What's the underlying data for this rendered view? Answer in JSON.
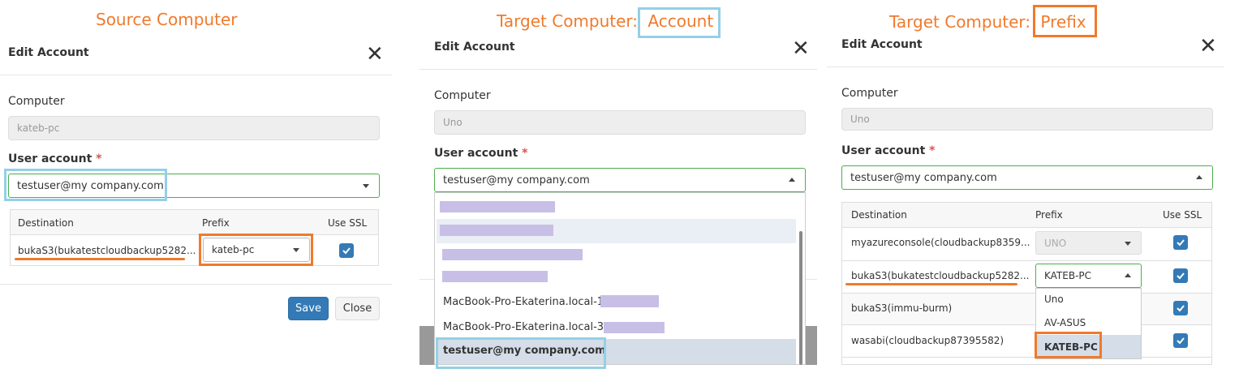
{
  "colors": {
    "accent_orange": "#f07a2c",
    "accent_blue": "#93d0e6",
    "primary": "#337ab7",
    "required": "#d9534f"
  },
  "panel1": {
    "caption": "Source Computer",
    "title": "Edit Account",
    "computer_label": "Computer",
    "computer_value": "kateb-pc",
    "user_account_label": "User account",
    "required_mark": "*",
    "user_account_value": "testuser@my company.com",
    "table_headers": {
      "destination": "Destination",
      "prefix": "Prefix",
      "use_ssl": "Use SSL"
    },
    "rows": [
      {
        "destination": "bukaS3(bukatestcloudbackup5282...",
        "prefix": "kateb-pc",
        "use_ssl": true
      }
    ],
    "save_label": "Save",
    "close_label": "Close"
  },
  "panel2": {
    "caption_prefix": "Target Computer: ",
    "caption_highlight": "Account",
    "title": "Edit Account",
    "computer_label": "Computer",
    "computer_value": "Uno",
    "user_account_label": "User account",
    "required_mark": "*",
    "user_account_value": "testuser@my company.com",
    "dropdown_options": [
      "",
      "",
      "",
      "",
      "MacBook-Pro-Ekaterina.local-1E",
      "MacBook-Pro-Ekaterina.local-3A3",
      "testuser@my company.com"
    ]
  },
  "panel3": {
    "caption_prefix": "Target Computer: ",
    "caption_highlight": "Prefix",
    "title": "Edit Account",
    "computer_label": "Computer",
    "computer_value": "Uno",
    "user_account_label": "User account",
    "required_mark": "*",
    "user_account_value": "testuser@my company.com",
    "table_headers": {
      "destination": "Destination",
      "prefix": "Prefix",
      "use_ssl": "Use SSL"
    },
    "rows": [
      {
        "destination": "myazureconsole(cloudbackup8359...",
        "prefix": "UNO",
        "use_ssl": true
      },
      {
        "destination": "bukaS3(bukatestcloudbackup5282...",
        "prefix": "KATEB-PC",
        "use_ssl": true
      },
      {
        "destination": "bukaS3(immu-burm)",
        "prefix": "",
        "use_ssl": true
      },
      {
        "destination": "wasabi(cloudbackup87395582)",
        "prefix": "",
        "use_ssl": true
      }
    ],
    "prefix_options": [
      "Uno",
      "AV-ASUS",
      "KATEB-PC"
    ]
  }
}
